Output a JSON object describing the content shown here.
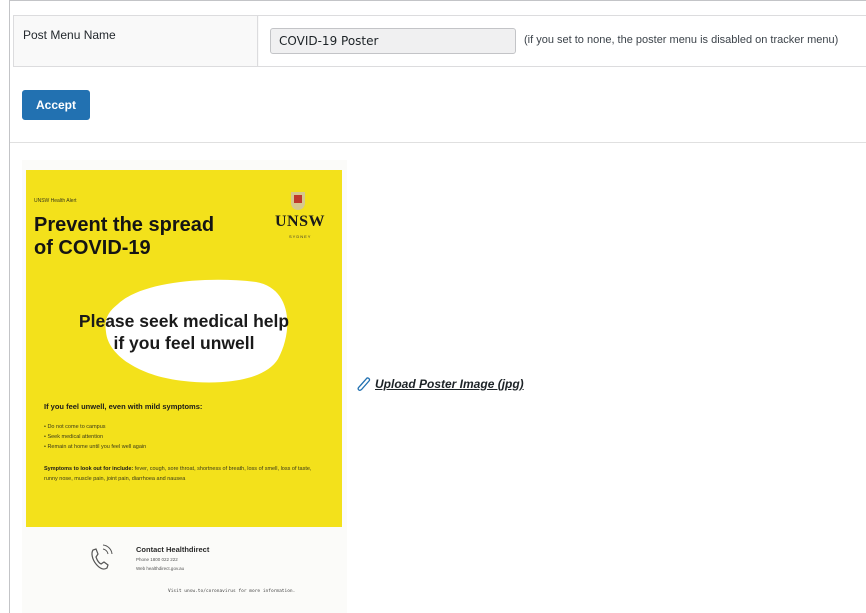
{
  "settings": {
    "post_menu_label": "Post Menu Name",
    "post_menu_value": "COVID-19 Poster",
    "post_menu_hint": "(if you set to none, the poster menu is disabled on tracker menu)"
  },
  "accept_button": "Accept",
  "poster": {
    "alert_label": "UNSW Health Alert",
    "title_line1": "Prevent the spread",
    "title_line2": "of COVID-19",
    "logo_text": "UNSW",
    "logo_subtext": "SYDNEY",
    "message_line1": "Please seek medical help",
    "message_line2": "if you feel unwell",
    "symptoms_heading": "If you feel unwell, even with mild symptoms:",
    "bullets": [
      "• Do not come to campus",
      "• Seek medical attention",
      "• Remain at home until you feel well again"
    ],
    "symptoms_label": "Symptoms to look out for include:",
    "symptoms_list": " fever, cough, sore throat, shortness of breath, loss of smell, loss of taste, runny nose, muscle pain, joint pain, diarrhoea and nausea",
    "contact_title": "Contact Healthdirect",
    "contact_phone": "Phone 1800 022 222",
    "contact_web": "Web healthdirect.gov.au",
    "visit_line": "Visit unsw.to/coronavirus for more information.",
    "colors": {
      "background": "#f3e11b",
      "text": "#141414"
    }
  },
  "upload": {
    "label": "Upload Poster Image (jpg)",
    "icon": "paperclip-icon"
  },
  "colors": {
    "accent": "#2271b1"
  }
}
